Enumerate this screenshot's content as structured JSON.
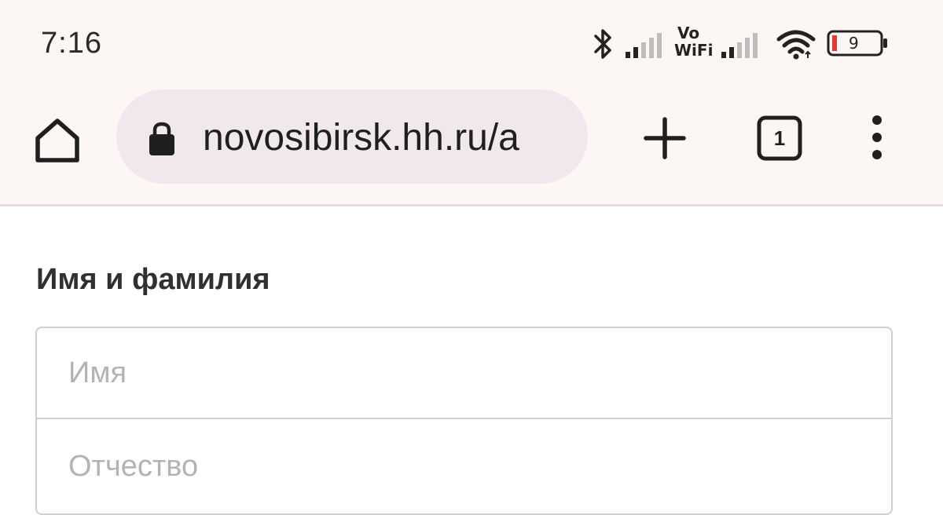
{
  "status_bar": {
    "time": "7:16",
    "volte_line1": "Vo",
    "volte_line2": "WiFi",
    "battery_level": "9",
    "icons": [
      "bluetooth-icon",
      "signal-icon",
      "vowifi-icon",
      "signal-icon",
      "wifi-icon",
      "battery-icon"
    ],
    "battery_color": "#e53935"
  },
  "toolbar": {
    "url": "novosibirsk.hh.ru/a",
    "tab_count": "1",
    "icons": [
      "home-icon",
      "lock-icon",
      "plus-icon",
      "tab-switcher-icon",
      "more-vert-icon"
    ]
  },
  "form": {
    "section_title": "Имя и фамилия",
    "first_name_placeholder": "Имя",
    "first_name_value": "",
    "middle_name_placeholder": "Отчество",
    "middle_name_value": ""
  }
}
